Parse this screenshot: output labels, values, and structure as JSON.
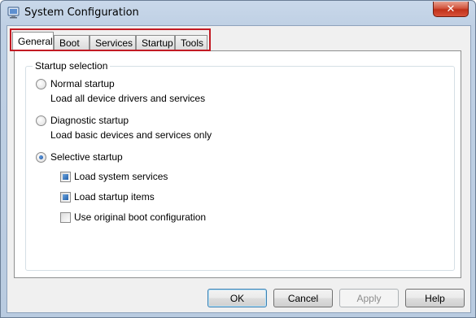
{
  "window": {
    "title": "System Configuration",
    "close_symbol": "✕"
  },
  "tabs": [
    {
      "label": "General",
      "active": true
    },
    {
      "label": "Boot",
      "active": false
    },
    {
      "label": "Services",
      "active": false
    },
    {
      "label": "Startup",
      "active": false
    },
    {
      "label": "Tools",
      "active": false
    }
  ],
  "general": {
    "group_label": "Startup selection",
    "normal": {
      "label": "Normal startup",
      "description": "Load all device drivers and services",
      "selected": false
    },
    "diagnostic": {
      "label": "Diagnostic startup",
      "description": "Load basic devices and services only",
      "selected": false
    },
    "selective": {
      "label": "Selective startup",
      "selected": true
    },
    "options": [
      {
        "label": "Load system services",
        "checked": true
      },
      {
        "label": "Load startup items",
        "checked": true
      },
      {
        "label": "Use original boot configuration",
        "checked": false
      }
    ]
  },
  "buttons": {
    "ok": "OK",
    "cancel": "Cancel",
    "apply": "Apply",
    "help": "Help"
  },
  "colors": {
    "highlight": "#c21a23",
    "accent": "#1f5ea8"
  },
  "icons": {
    "app": "system-configuration-icon",
    "close": "close-icon"
  }
}
